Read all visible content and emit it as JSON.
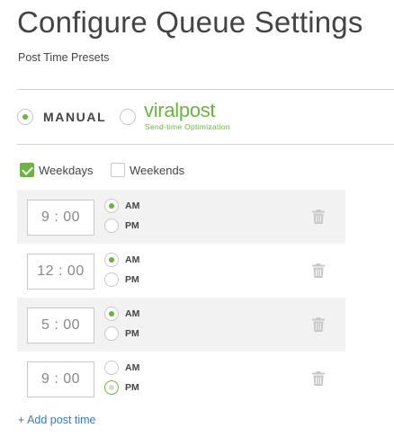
{
  "header": {
    "title": "Configure Queue Settings",
    "subtitle": "Post Time Presets"
  },
  "mode": {
    "manual_label": "MANUAL",
    "manual_selected": true,
    "viralpost_logo": "viralpost",
    "viralpost_tagline": "Send-time Optimization",
    "viralpost_selected": false
  },
  "days": {
    "weekdays_label": "Weekdays",
    "weekdays_checked": true,
    "weekends_label": "Weekends",
    "weekends_checked": false
  },
  "post_times": [
    {
      "hour": "9",
      "separator": ":",
      "minute": "00",
      "am_label": "AM",
      "pm_label": "PM",
      "period": "AM"
    },
    {
      "hour": "12",
      "separator": ":",
      "minute": "00",
      "am_label": "AM",
      "pm_label": "PM",
      "period": "AM"
    },
    {
      "hour": "5",
      "separator": ":",
      "minute": "00",
      "am_label": "AM",
      "pm_label": "PM",
      "period": "AM"
    },
    {
      "hour": "9",
      "separator": ":",
      "minute": "00",
      "am_label": "AM",
      "pm_label": "PM",
      "period": "PM"
    }
  ],
  "add_post_time_label": "+ Add post time",
  "icons": {
    "delete": "trash-icon"
  },
  "colors": {
    "accent_green": "#6ab43f",
    "link_blue": "#3a7bbf",
    "row_shade": "#f2f2f2"
  }
}
